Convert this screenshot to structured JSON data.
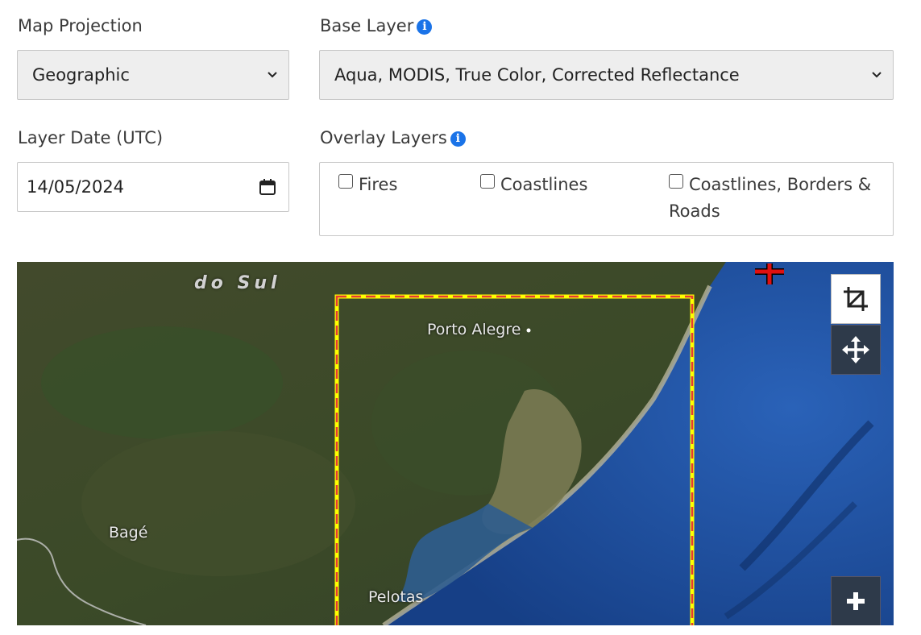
{
  "projection": {
    "label": "Map Projection",
    "selected": "Geographic"
  },
  "base_layer": {
    "label": "Base Layer",
    "selected": "Aqua, MODIS, True Color, Corrected Reflectance",
    "info_icon": "info-circle-icon"
  },
  "layer_date": {
    "label": "Layer Date (UTC)",
    "value": "14/05/2024",
    "icon": "calendar-icon"
  },
  "overlay_layers": {
    "label": "Overlay Layers",
    "info_icon": "info-circle-icon",
    "options": [
      {
        "label": "Fires",
        "checked": false
      },
      {
        "label": "Coastlines",
        "checked": false
      },
      {
        "label": "Coastlines, Borders &",
        "label_cont": "Roads",
        "checked": false
      }
    ]
  },
  "map": {
    "region_label": "do Sul",
    "places": [
      "Porto Alegre",
      "Bagé",
      "Pelotas"
    ],
    "controls": {
      "crop": "crop-icon",
      "move": "move-arrows-icon",
      "zoom_in": "plus-icon"
    },
    "colors": {
      "selection_outer": "#ffff00",
      "selection_dash": "#e53935",
      "ocean": "#1f4f9c",
      "land": "#3c4527"
    }
  }
}
